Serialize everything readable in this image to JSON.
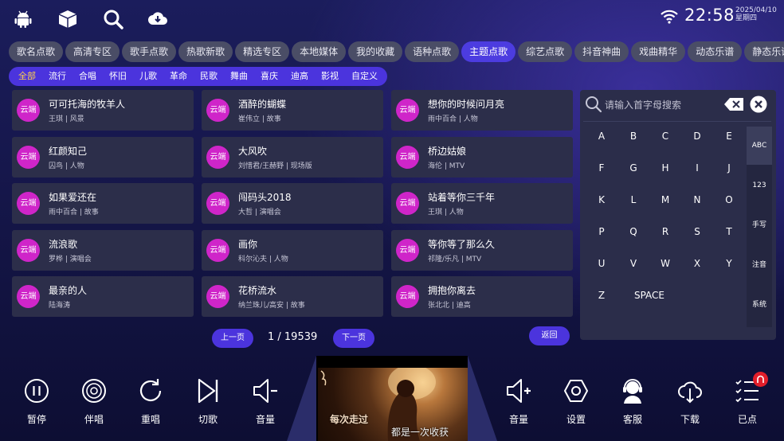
{
  "status": {
    "time": "22:58",
    "date": "2025/04/10",
    "weekday": "星期四"
  },
  "top_icons": [
    "android-icon",
    "box-icon",
    "search-icon",
    "cloud-download-icon",
    "wifi-icon"
  ],
  "categories": [
    {
      "label": "歌名点歌",
      "active": false
    },
    {
      "label": "高清专区",
      "active": false
    },
    {
      "label": "歌手点歌",
      "active": false
    },
    {
      "label": "热歌新歌",
      "active": false
    },
    {
      "label": "精选专区",
      "active": false
    },
    {
      "label": "本地媒体",
      "active": false
    },
    {
      "label": "我的收藏",
      "active": false
    },
    {
      "label": "语种点歌",
      "active": false
    },
    {
      "label": "主题点歌",
      "active": true
    },
    {
      "label": "综艺点歌",
      "active": false
    },
    {
      "label": "抖音神曲",
      "active": false
    },
    {
      "label": "戏曲精华",
      "active": false
    },
    {
      "label": "动态乐谱",
      "active": false
    },
    {
      "label": "静态乐谱",
      "active": false
    }
  ],
  "subcategories": [
    {
      "label": "全部",
      "active": true
    },
    {
      "label": "流行",
      "active": false
    },
    {
      "label": "合唱",
      "active": false
    },
    {
      "label": "怀旧",
      "active": false
    },
    {
      "label": "儿歌",
      "active": false
    },
    {
      "label": "革命",
      "active": false
    },
    {
      "label": "民歌",
      "active": false
    },
    {
      "label": "舞曲",
      "active": false
    },
    {
      "label": "喜庆",
      "active": false
    },
    {
      "label": "迪高",
      "active": false
    },
    {
      "label": "影视",
      "active": false
    },
    {
      "label": "自定义",
      "active": false
    }
  ],
  "badge_label": "云端",
  "songs": [
    {
      "title": "可可托海的牧羊人",
      "meta": "王琪 | 风景"
    },
    {
      "title": "酒醉的蝴蝶",
      "meta": "崔伟立 | 故事"
    },
    {
      "title": "想你的时候问月亮",
      "meta": "雨中百合 | 人物"
    },
    {
      "title": "红颜知己",
      "meta": "囚鸟 | 人物"
    },
    {
      "title": "大风吹",
      "meta": "刘惜君/王赫野 | 现场版"
    },
    {
      "title": "桥边姑娘",
      "meta": "海伦 | MTV"
    },
    {
      "title": "如果爱还在",
      "meta": "雨中百合 | 故事"
    },
    {
      "title": "闯码头2018",
      "meta": "大哲 | 演唱会"
    },
    {
      "title": "站着等你三千年",
      "meta": "王琪 | 人物"
    },
    {
      "title": "流浪歌",
      "meta": "罗桦 | 演唱会"
    },
    {
      "title": "画你",
      "meta": "科尔沁夫 | 人物"
    },
    {
      "title": "等你等了那么久",
      "meta": "祁隆/乐凡 | MTV"
    },
    {
      "title": "最亲的人",
      "meta": "陆海涛"
    },
    {
      "title": "花桥流水",
      "meta": "纳兰珠儿/高安 | 故事"
    },
    {
      "title": "拥抱你离去",
      "meta": "张北北 | 迪高"
    }
  ],
  "pagination": {
    "prev": "上一页",
    "next": "下一页",
    "indicator": "1 / 19539",
    "back": "返回"
  },
  "keyboard": {
    "placeholder": "请输入首字母搜索",
    "keys": [
      "A",
      "B",
      "C",
      "D",
      "E",
      "F",
      "G",
      "H",
      "I",
      "J",
      "K",
      "L",
      "M",
      "N",
      "O",
      "P",
      "Q",
      "R",
      "S",
      "T",
      "U",
      "V",
      "W",
      "X",
      "Y",
      "Z"
    ],
    "space": "SPACE",
    "modes": [
      {
        "label": "ABC",
        "active": true
      },
      {
        "label": "123",
        "active": false
      },
      {
        "label": "手写",
        "active": false
      },
      {
        "label": "注音",
        "active": false
      },
      {
        "label": "系统",
        "active": false
      }
    ]
  },
  "controls": {
    "pause": "暂停",
    "accomp": "伴唱",
    "replay": "重唱",
    "skip": "切歌",
    "vol_down": "音量",
    "vol_up": "音量",
    "settings": "设置",
    "service": "客服",
    "download": "下载",
    "selected": "已点"
  },
  "video": {
    "caption_top": "每次走过",
    "caption_bottom": "都是一次收获"
  },
  "colors": {
    "accent": "#4b34dd",
    "badge": "#cf25c9",
    "active_sub": "#ffd24a",
    "notification": "#e21e2a"
  }
}
